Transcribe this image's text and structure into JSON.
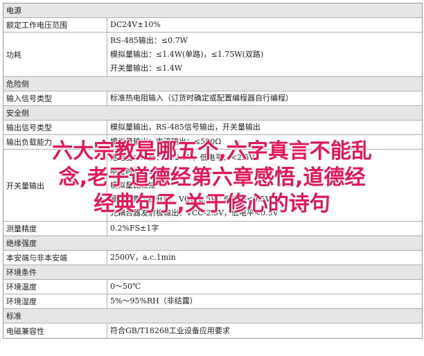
{
  "rows": [
    {
      "type": "section",
      "label": "电源"
    },
    {
      "type": "item",
      "label": "额定工作电压范围",
      "values": [
        "DC24V±10%"
      ]
    },
    {
      "type": "item",
      "label": "功耗",
      "values": [
        "RS-485输出：≤0.7W",
        "模拟量输出：≤1.4W(单路)，≤1.75W(双路)",
        "开关量输出：≤1.4W"
      ]
    },
    {
      "type": "section",
      "label": "危险侧"
    },
    {
      "type": "item",
      "label": "输入信号类型",
      "values": [
        "标准热电阻输入（订货时确定或配置编程器自行编程）"
      ]
    },
    {
      "type": "section",
      "label": "安全侧"
    },
    {
      "type": "item",
      "label": "输出信号类型",
      "values": [
        "模拟量输出，RS-485信号输出，开关量输出"
      ]
    },
    {
      "type": "item",
      "label": "输出负载能力",
      "values": [
        "模拟量输出：电流输出：≤500Ω"
      ]
    },
    {
      "type": "item",
      "label": "开关量输出",
      "values": [
        "继电器：…至：>12.5V，低电平：<2.5V",
        "响应时间：≤1ms",
        "模拟量比较接",
        "晶体管集电极开路：VCC-2.5V，低电平<0.5V",
        "光耦合器发射极输出：VCC-2.5V，低电平<0.5V"
      ]
    },
    {
      "type": "item",
      "label": "测量精度",
      "values": [
        "0.2%FS±1字"
      ]
    },
    {
      "type": "section",
      "label": "绝缘强度"
    },
    {
      "type": "item",
      "label": "本安端与非本安端",
      "values": [
        "2500V，a.c.1min"
      ]
    },
    {
      "type": "section",
      "label": "环境条件"
    },
    {
      "type": "item",
      "label": "环境温度",
      "values": [
        "0～50℃"
      ]
    },
    {
      "type": "item",
      "label": "环境湿度",
      "values": [
        "5%～95%RH（非结露）"
      ]
    },
    {
      "type": "section",
      "label": "标准"
    },
    {
      "type": "item",
      "label": "电磁兼容性",
      "values": [
        "符合GB/T18268工业设备应用要求"
      ]
    }
  ],
  "overlay": {
    "lines": [
      "六大宗教是哪五个,六字真言不能乱",
      "念,老子道德经第六章感悟,道德经",
      "经典句子,关于修心的诗句"
    ],
    "color": "#e0185c"
  }
}
